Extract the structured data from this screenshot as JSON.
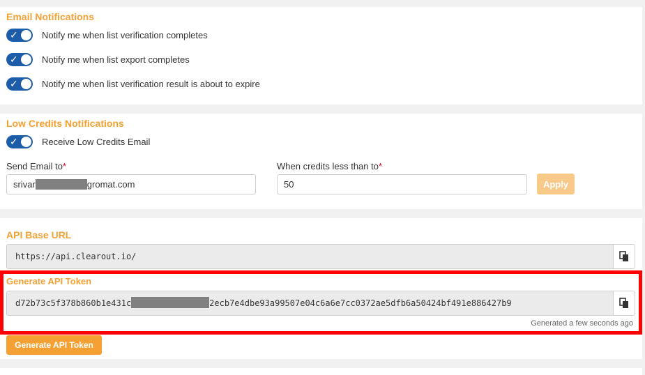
{
  "email_notifications": {
    "title": "Email Notifications",
    "items": [
      {
        "label": "Notify me when list verification completes",
        "enabled": true
      },
      {
        "label": "Notify me when list export completes",
        "enabled": true
      },
      {
        "label": "Notify me when list verification result is about to expire",
        "enabled": true
      }
    ]
  },
  "low_credits": {
    "title": "Low Credits Notifications",
    "receive_label": "Receive Low Credits Email",
    "receive_enabled": true,
    "send_email_label": "Send Email to",
    "send_email_prefix": "srivar",
    "send_email_suffix": "gromat.com",
    "threshold_label": "When credits less than to",
    "threshold_value": "50",
    "required_mark": "*",
    "apply_label": "Apply"
  },
  "api": {
    "base_url_title": "API Base URL",
    "base_url_value": "https://api.clearout.io/",
    "token_title": "Generate API Token",
    "token_prefix": "d72b73c5f378b860b1e431c",
    "token_suffix": "2ecb7e4dbe93a99507e04c6a6e7cc0372ae5dfb6a50424bf491e886427b9",
    "generated_note": "Generated a few seconds ago",
    "generate_button": "Generate API Token"
  },
  "colors": {
    "accent": "#f5a033",
    "toggle_on": "#1d5ca8",
    "highlight": "#ff0000"
  },
  "icons": {
    "toggle_check": "✓",
    "copy": "copy-icon"
  }
}
